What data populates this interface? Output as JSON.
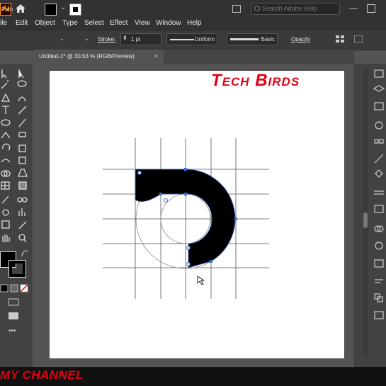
{
  "app": {
    "logo_text": "Ai",
    "search_placeholder": "Search Adobe Help"
  },
  "menu": [
    "ile",
    "Edit",
    "Object",
    "Type",
    "Select",
    "Effect",
    "View",
    "Window",
    "Help"
  ],
  "control_bar": {
    "selection_label": "Path",
    "stroke_label": "Stroke:",
    "stroke_value": "1 pt",
    "profile": "Uniform",
    "brush": "Basic",
    "opacity_label": "Opacity",
    "fill_color": "#000000",
    "stroke_color": "#ffffff"
  },
  "document_tab": {
    "title": "Untitled-1* @ 30.53 % (RGB/Preview)",
    "close": "×"
  },
  "canvas": {
    "headline": "Tech Birds",
    "shape_fill": "#000000",
    "headline_color": "#e10014"
  },
  "banner": {
    "text": "MY CHANNEL"
  },
  "toolbar": {
    "more": "•••"
  }
}
